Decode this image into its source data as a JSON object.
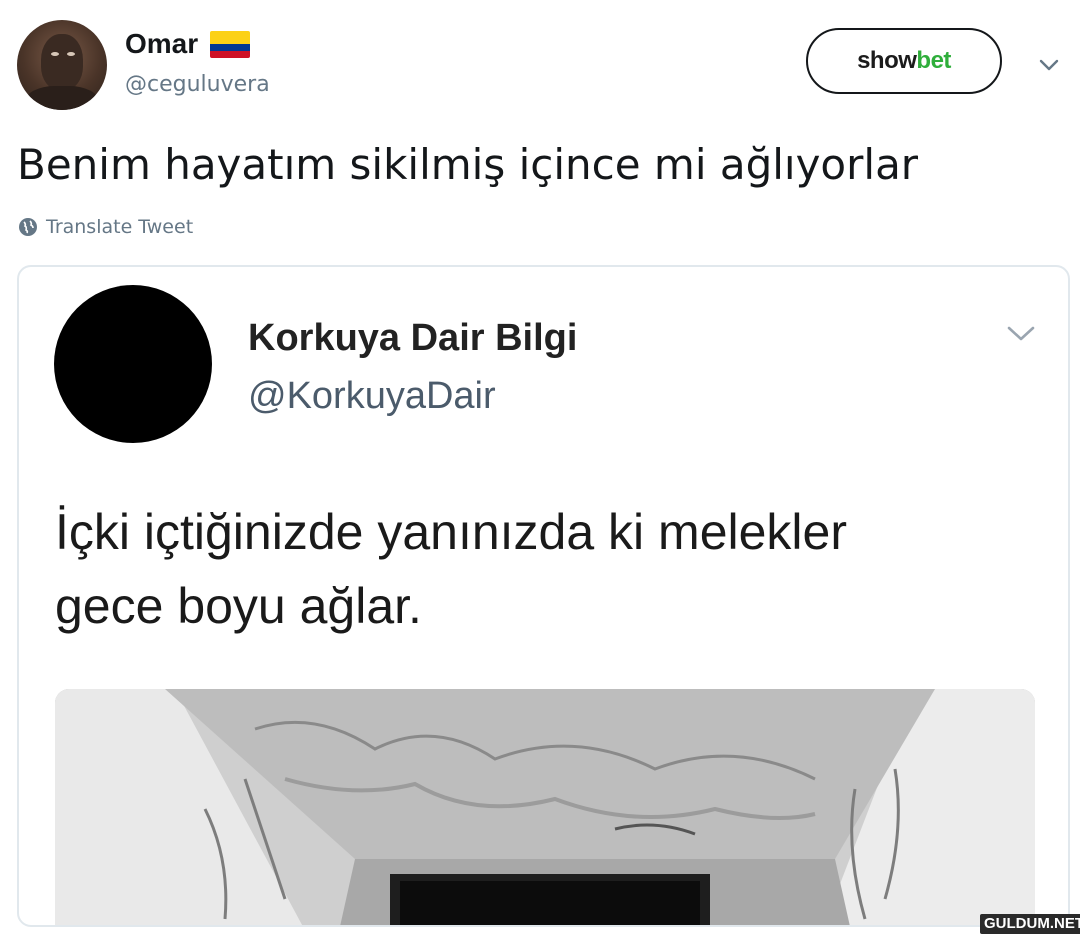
{
  "tweet": {
    "author_name": "Omar",
    "author_handle": "@ceguluvera",
    "text": "Benim hayatım sikilmiş içince mi ağlıyorlar",
    "translate_label": "Translate Tweet",
    "follow_button": {
      "brand_part1": "show",
      "brand_part2": "bet"
    },
    "flag_colors": [
      "#fcd116",
      "#003893",
      "#ce1126"
    ]
  },
  "quoted_tweet": {
    "author_name": "Korkuya Dair Bilgi",
    "author_handle": "@KorkuyaDair",
    "text": "İçki içtiğinizde yanınızda ki melekler gece boyu ağlar."
  },
  "watermark": "GULDUM.NET",
  "icons": [
    "chevron-down-icon",
    "globe-icon",
    "colombia-flag-icon"
  ],
  "colors": {
    "text": "#14171a",
    "muted": "#657786",
    "border": "#e1e8ed",
    "brand_green": "#2fae3b"
  }
}
